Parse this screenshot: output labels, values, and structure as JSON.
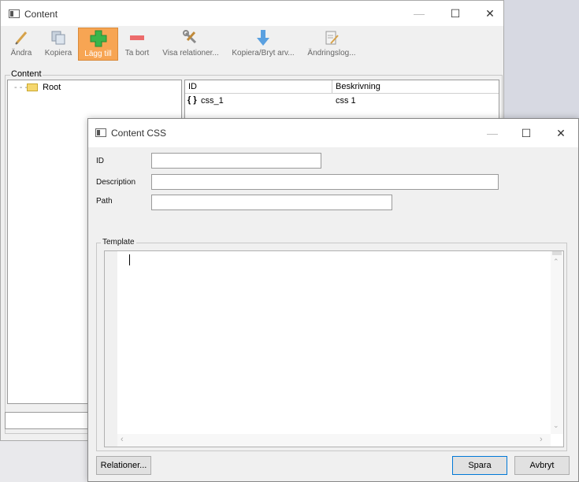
{
  "main_window": {
    "title": "Content",
    "toolbar": [
      {
        "label": "Ändra",
        "icon": "pencil-icon"
      },
      {
        "label": "Kopiera",
        "icon": "copy-icon"
      },
      {
        "label": "Lägg till",
        "icon": "plus-icon",
        "active": true
      },
      {
        "label": "Ta bort",
        "icon": "minus-icon"
      },
      {
        "label": "Visa relationer...",
        "icon": "tools-icon"
      },
      {
        "label": "Kopiera/Bryt arv...",
        "icon": "arrow-down-icon"
      },
      {
        "label": "Ändringslog...",
        "icon": "document-edit-icon"
      }
    ],
    "content_group_label": "Content",
    "tree_root": "Root",
    "list": {
      "columns": [
        "ID",
        "Beskrivning"
      ],
      "rows": [
        {
          "icon": "{ }",
          "id": "css_1",
          "description": "css 1"
        }
      ]
    },
    "status_field_value": ""
  },
  "dialog": {
    "title": "Content CSS",
    "fields": {
      "id_label": "ID",
      "id_value": "",
      "description_label": "Description",
      "description_value": "",
      "path_label": "Path",
      "path_value": ""
    },
    "template_label": "Template",
    "template_value": "",
    "buttons": {
      "relations": "Relationer...",
      "save": "Spara",
      "cancel": "Avbryt"
    }
  },
  "colors": {
    "active_button": "#f7a553",
    "window_bg": "#f0f0f0",
    "desktop": "#d7d9e2",
    "default_button_border": "#0078d7"
  }
}
